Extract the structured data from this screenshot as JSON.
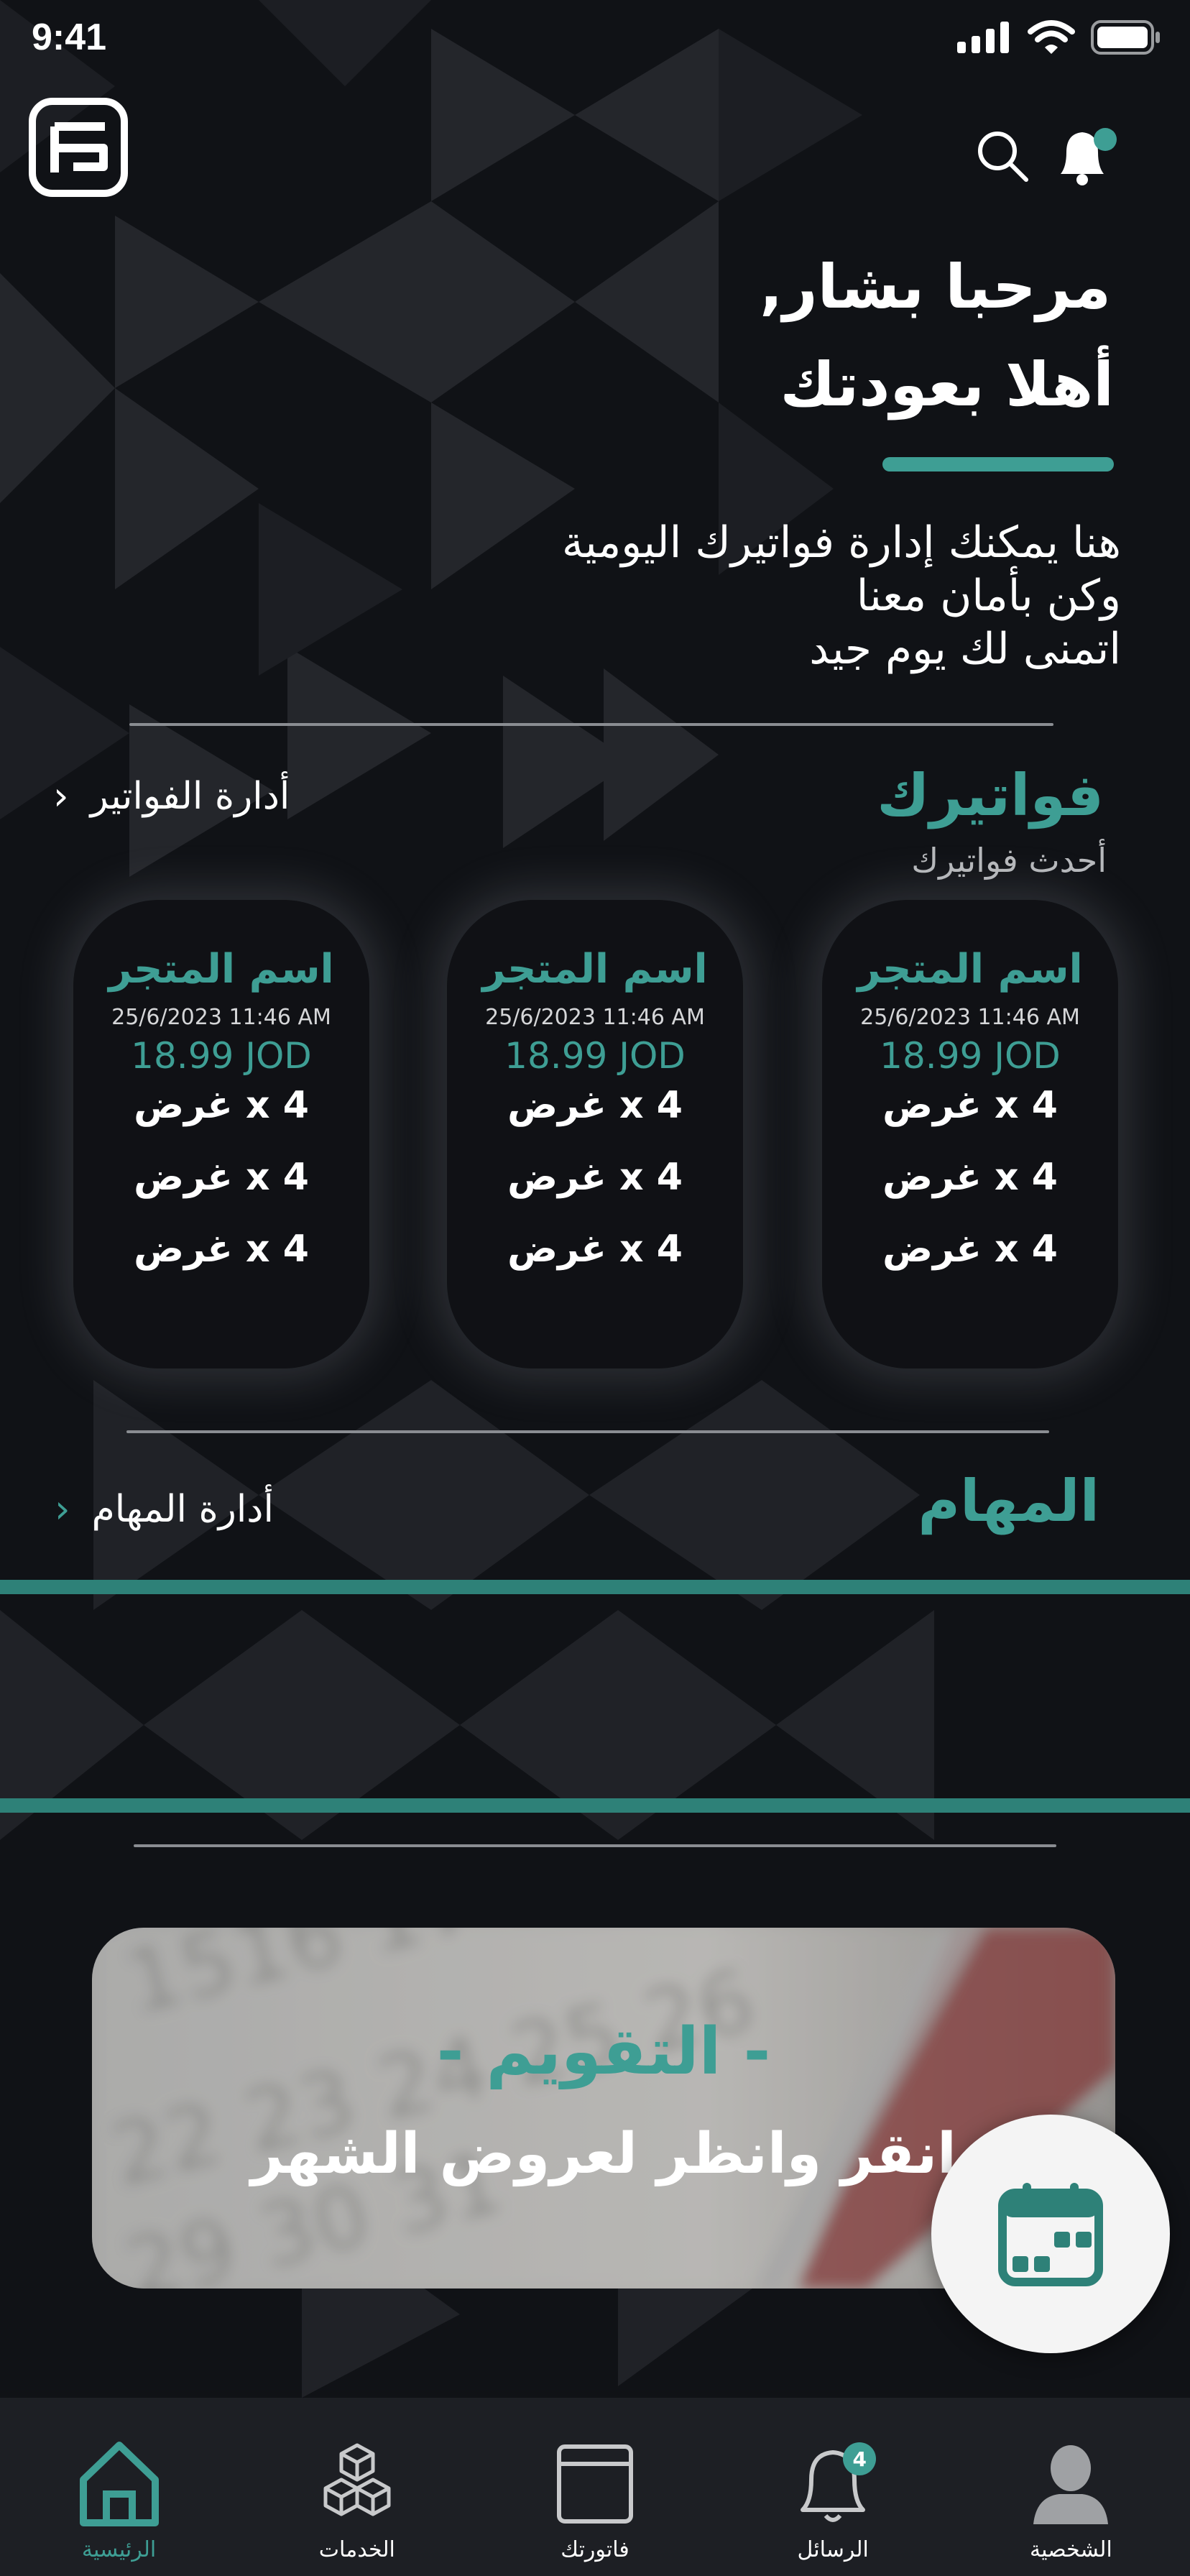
{
  "status_bar": {
    "time": "9:41"
  },
  "header": {
    "logo_icon": "app-logo-icon",
    "search_icon": "search-icon",
    "notification_icon": "bell-icon"
  },
  "greeting": {
    "line1": "مرحبا بشار,",
    "line2": "أهلا بعودتك"
  },
  "intro": {
    "line1": "هنا يمكنك إدارة فواتيرك اليومية",
    "line2": "وكن بأمان معنا",
    "line3": "اتمنى لك يوم جيد"
  },
  "invoices_section": {
    "title": "فواتيرك",
    "subtitle": "أحدث فواتيرك",
    "manage_link": "أدارة الفواتير",
    "cards": [
      {
        "store": "اسم المتجر",
        "date": "25/6/2023 11:46 AM",
        "total": "18.99 JOD",
        "items": [
          "4 x غرض",
          "4 x غرض",
          "4 x غرض"
        ]
      },
      {
        "store": "اسم المتجر",
        "date": "25/6/2023 11:46 AM",
        "total": "18.99 JOD",
        "items": [
          "4 x غرض",
          "4 x غرض",
          "4 x غرض"
        ]
      },
      {
        "store": "اسم المتجر",
        "date": "25/6/2023 11:46 AM",
        "total": "18.99 JOD",
        "items": [
          "4 x غرض",
          "4 x غرض",
          "4 x غرض"
        ]
      }
    ]
  },
  "tasks_section": {
    "title": "المهام",
    "manage_link": "أدارة المهام"
  },
  "calendar_banner": {
    "title": "- التقويم -",
    "subtitle": "انقر وانظر لعروض الشهر"
  },
  "bottom_nav": {
    "items": [
      {
        "label": "الرئيسية",
        "icon": "home-icon",
        "active": true
      },
      {
        "label": "الخدمات",
        "icon": "boxes-icon"
      },
      {
        "label": "فاتورتك",
        "icon": "invoice-window-icon"
      },
      {
        "label": "الرسائل",
        "icon": "bell-icon",
        "badge": "4"
      },
      {
        "label": "الشخصية",
        "icon": "person-icon"
      }
    ]
  },
  "colors": {
    "accent": "#3e9e94",
    "background": "#101216",
    "nav_background": "#1d1f24"
  }
}
